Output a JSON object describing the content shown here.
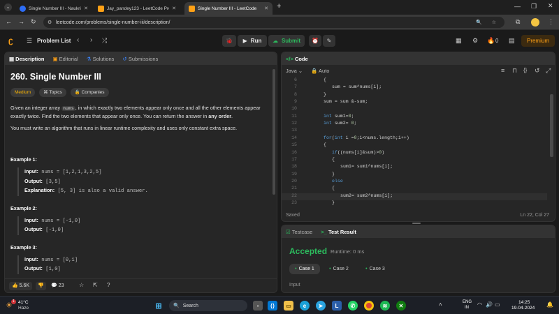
{
  "browser": {
    "tabs": [
      {
        "label": "Single Number III - Naukri Co...",
        "favicon_color": "#2d6df6"
      },
      {
        "label": "Jay_pandey123 - LeetCode Pro...",
        "favicon_color": "#ffa116"
      },
      {
        "label": "Single Number III - LeetCode",
        "favicon_color": "#ffa116"
      }
    ],
    "url": "leetcode.com/problems/single-number-iii/description/"
  },
  "nav": {
    "problem_list": "Problem List",
    "run": "Run",
    "submit": "Submit",
    "streak": "0",
    "premium": "Premium"
  },
  "left_tabs": [
    "Description",
    "Editorial",
    "Solutions",
    "Submissions"
  ],
  "problem": {
    "title": "260. Single Number III",
    "difficulty": "Medium",
    "topics": "Topics",
    "companies": "Companies",
    "p1_a": "Given an integer array ",
    "p1_code": "nums",
    "p1_b": ", in which exactly two elements appear only once and all the other elements appear exactly twice. Find the two elements that appear only once. You can return the answer in ",
    "p1_bold": "any order",
    "p1_c": ".",
    "p2": "You must write an algorithm that runs in linear runtime complexity and uses only constant extra space.",
    "examples": [
      {
        "heading": "Example 1:",
        "input_label": "Input:",
        "input": "nums = [1,2,1,3,2,5]",
        "output_label": "Output:",
        "output": "[3,5]",
        "expl_label": "Explanation:",
        "expl": "[5, 3] is also a valid answer."
      },
      {
        "heading": "Example 2:",
        "input_label": "Input:",
        "input": "nums = [-1,0]",
        "output_label": "Output:",
        "output": "[-1,0]"
      },
      {
        "heading": "Example 3:",
        "input_label": "Input:",
        "input": "nums = [0,1]",
        "output_label": "Output:",
        "output": "[1,0]"
      }
    ],
    "likes": "5.6K",
    "comments": "23"
  },
  "editor": {
    "header": "Code",
    "language": "Java",
    "mode": "Auto",
    "saved": "Saved",
    "cursor": "Ln 22, Col 27",
    "lines": [
      {
        "n": "6",
        "indent": 2,
        "text": "{"
      },
      {
        "n": "7",
        "indent": 3,
        "text": "sum = sum^nums[i];"
      },
      {
        "n": "8",
        "indent": 2,
        "text": "}"
      },
      {
        "n": "9",
        "indent": 2,
        "text": "sum = sum &-sum;"
      },
      {
        "n": "10",
        "indent": 0,
        "text": ""
      },
      {
        "n": "11",
        "indent": 2,
        "text": "int sum1=0;"
      },
      {
        "n": "12",
        "indent": 2,
        "text": "int sum2= 0;"
      },
      {
        "n": "13",
        "indent": 0,
        "text": ""
      },
      {
        "n": "14",
        "indent": 2,
        "text": "for(int i =0;i<nums.length;i++)"
      },
      {
        "n": "15",
        "indent": 2,
        "text": "{"
      },
      {
        "n": "16",
        "indent": 3,
        "text": "if((nums[i]&sum)>0)"
      },
      {
        "n": "17",
        "indent": 3,
        "text": "{"
      },
      {
        "n": "18",
        "indent": 4,
        "text": "sum1= sum1^nums[i];"
      },
      {
        "n": "19",
        "indent": 3,
        "text": "}"
      },
      {
        "n": "20",
        "indent": 3,
        "text": "else"
      },
      {
        "n": "21",
        "indent": 3,
        "text": "{"
      },
      {
        "n": "22",
        "indent": 4,
        "text": "sum2= sum2^nums[i];"
      },
      {
        "n": "23",
        "indent": 3,
        "text": "}"
      }
    ]
  },
  "result": {
    "tab_testcase": "Testcase",
    "tab_result": "Test Result",
    "status": "Accepted",
    "runtime": "Runtime: 0 ms",
    "cases": [
      "Case 1",
      "Case 2",
      "Case 3"
    ],
    "input_label": "Input"
  },
  "taskbar": {
    "temp": "41°C",
    "weather": "Haze",
    "weather_badge": "1",
    "search": "Search",
    "lang_top": "ENG",
    "lang_bottom": "IN",
    "time": "14:25",
    "date": "19-04-2024"
  }
}
